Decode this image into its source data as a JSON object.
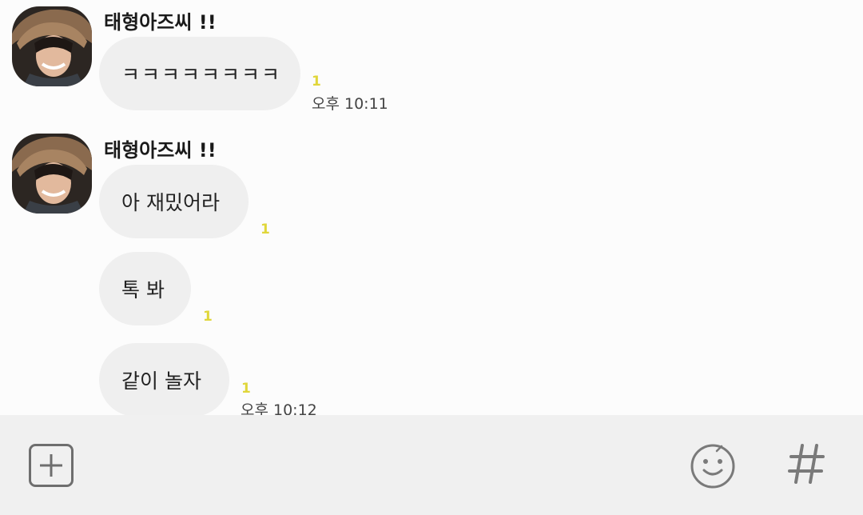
{
  "messages": [
    {
      "sender": "태형아즈씨 !!",
      "bubbles": [
        {
          "text": "ㅋㅋㅋㅋㅋㅋㅋㅋ",
          "unread": "1",
          "time": "오후 10:11"
        }
      ]
    },
    {
      "sender": "태형아즈씨 !!",
      "bubbles": [
        {
          "text": "아 재밌어라",
          "unread": "1",
          "time": ""
        },
        {
          "text": "톡 봐",
          "unread": "1",
          "time": ""
        },
        {
          "text": "같이 놀자",
          "unread": "1",
          "time": "오후 10:12"
        }
      ]
    }
  ],
  "input_bar": {
    "plus_icon": "plus-square-icon",
    "emoji_icon": "smiley-icon",
    "hash_icon": "hash-icon"
  },
  "colors": {
    "chat_background": "#fcfcfc",
    "bubble_background": "#efefef",
    "unread_count": "#e0d63a",
    "input_bar_background": "#f0f0f0",
    "icon_gray": "#7a7a7a"
  }
}
